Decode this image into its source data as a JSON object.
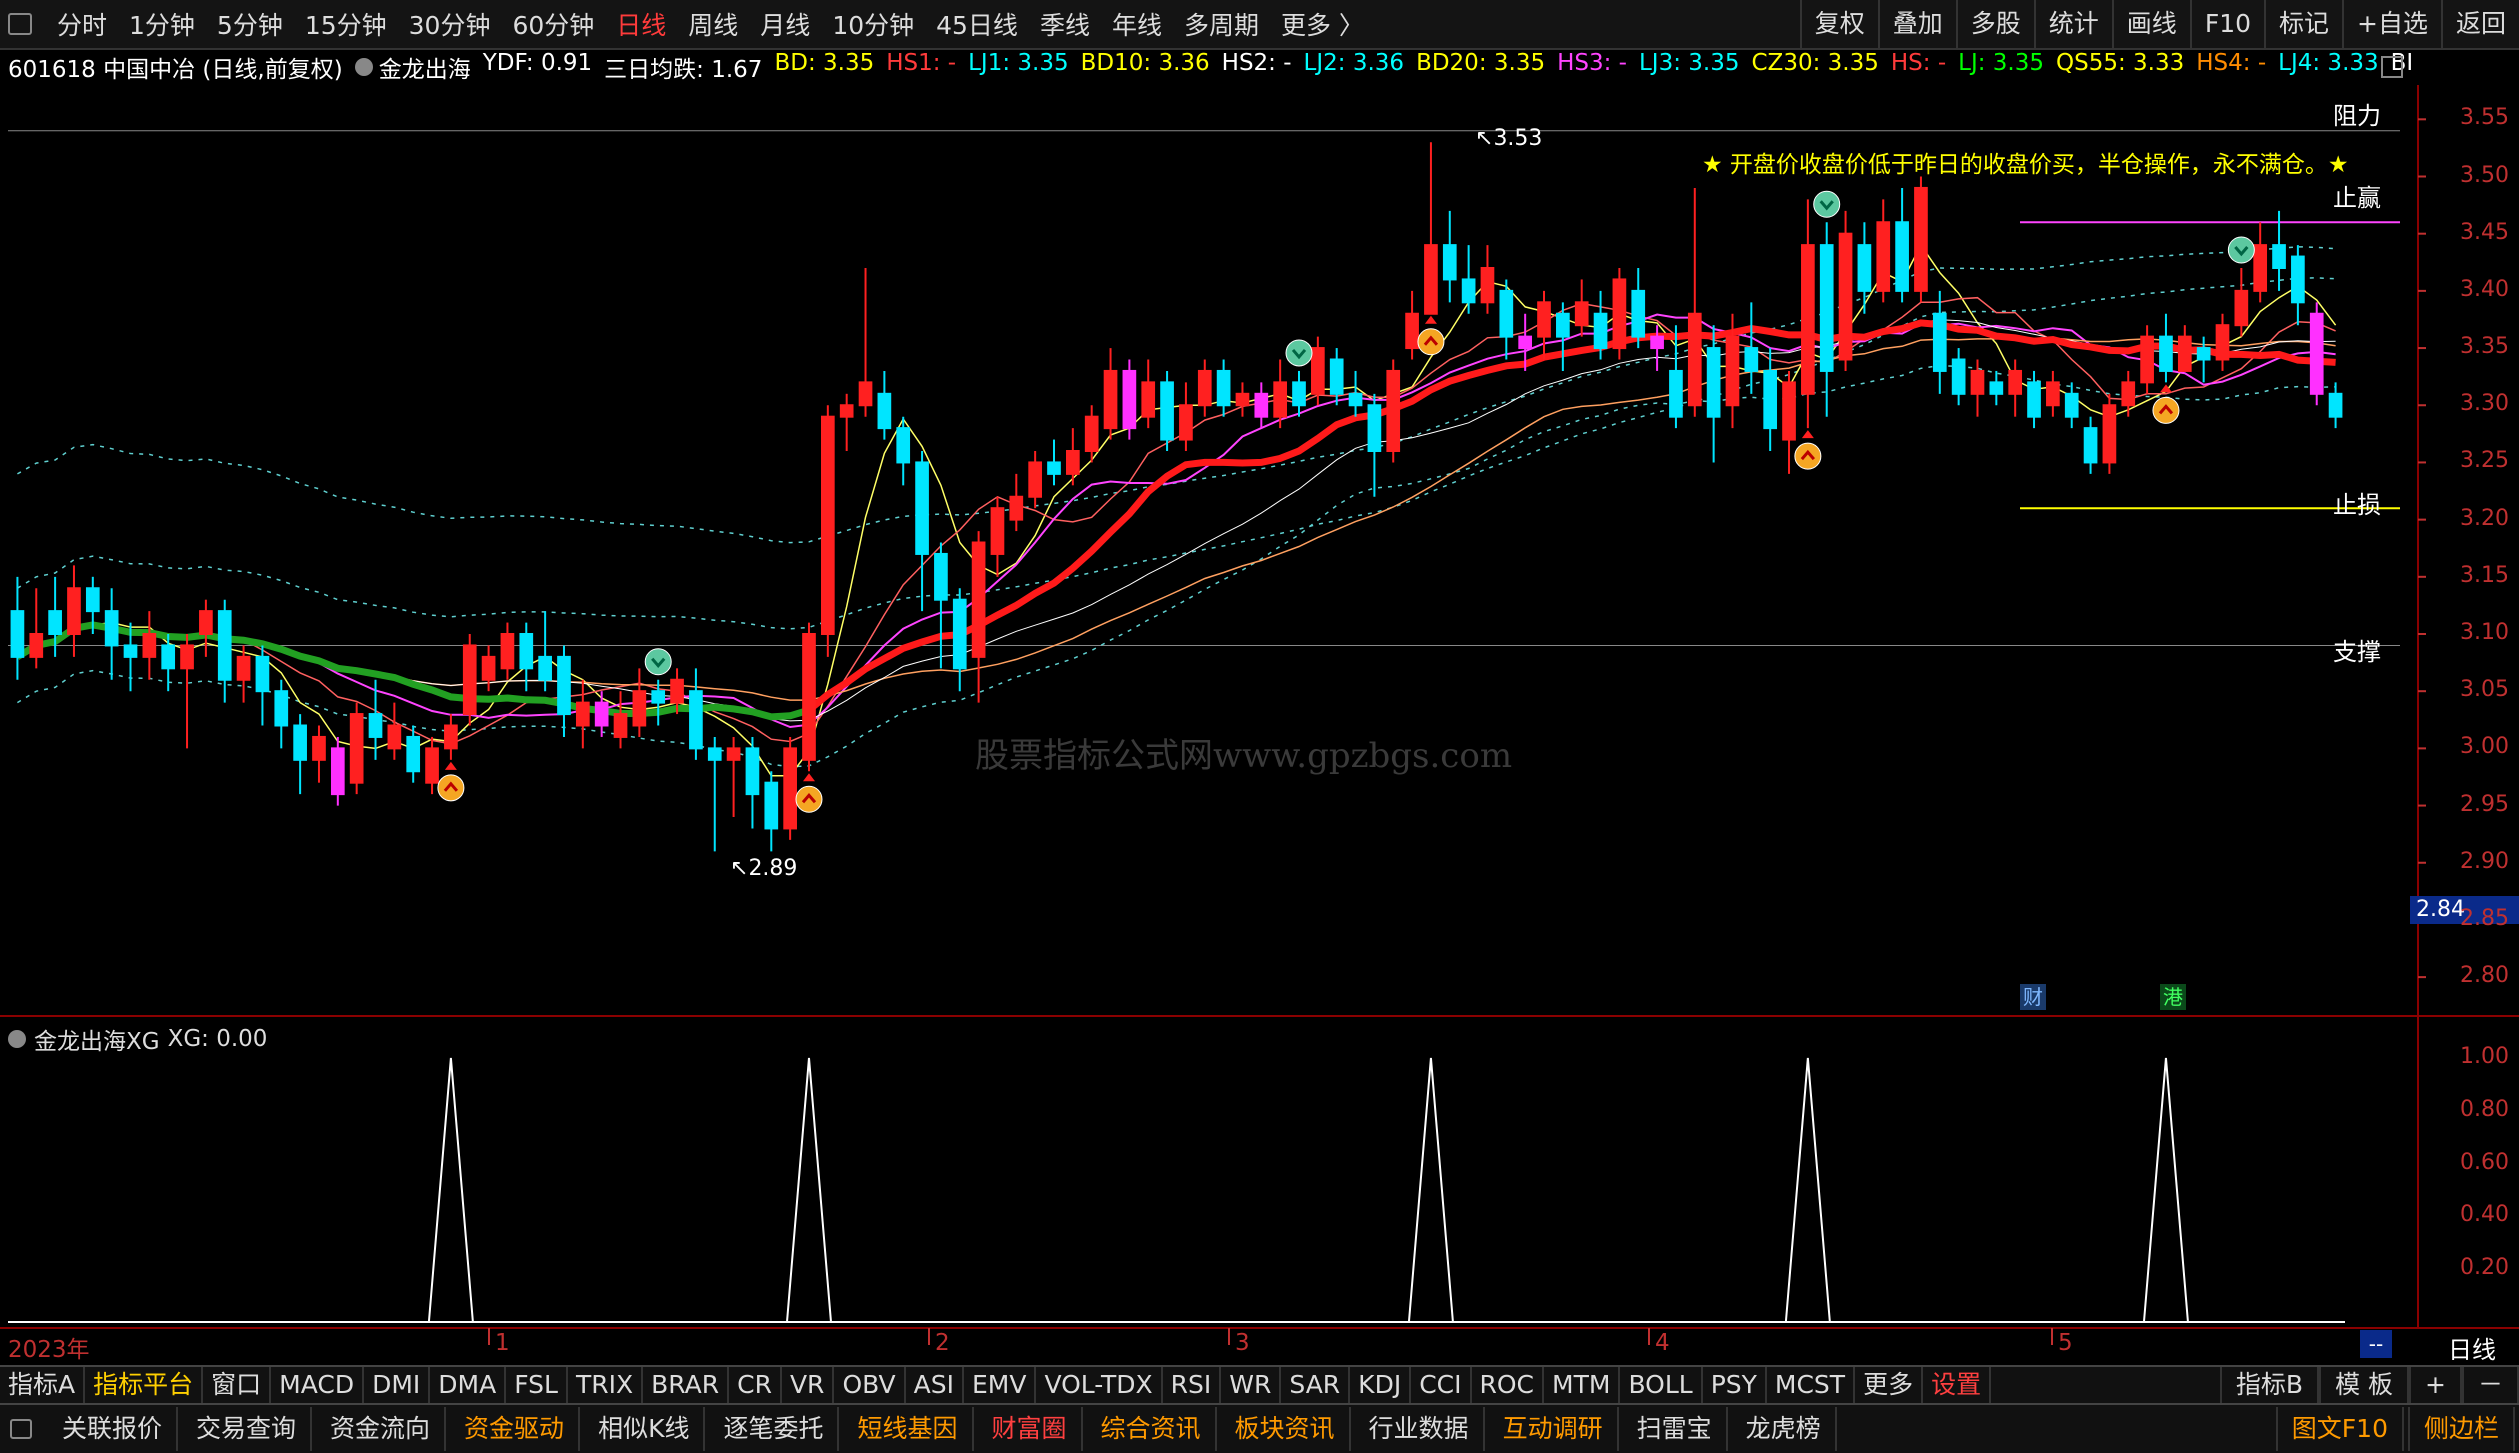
{
  "topbar": {
    "periods": [
      "分时",
      "1分钟",
      "5分钟",
      "15分钟",
      "30分钟",
      "60分钟",
      "日线",
      "周线",
      "月线",
      "10分钟",
      "45日线",
      "季线",
      "年线",
      "多周期",
      "更多 〉"
    ],
    "active_period": "日线",
    "right_buttons": [
      "复权",
      "叠加",
      "多股",
      "统计",
      "画线",
      "F10",
      "标记",
      "+自选",
      "返回"
    ]
  },
  "info": {
    "code_name": "601618 中国中冶 (日线,前复权)",
    "indicator": "金龙出海",
    "values": [
      {
        "text": "YDF: 0.91",
        "color": "#ffffff"
      },
      {
        "text": "三日均跌: 1.67",
        "color": "#ffffff"
      },
      {
        "text": "BD: 3.35",
        "color": "#ffff00"
      },
      {
        "text": "HS1: -",
        "color": "#ff3b3b"
      },
      {
        "text": "LJ1: 3.35",
        "color": "#00ffff"
      },
      {
        "text": "BD10: 3.36",
        "color": "#ffff00"
      },
      {
        "text": "HS2: -",
        "color": "#ffffff"
      },
      {
        "text": "LJ2: 3.36",
        "color": "#00ffff"
      },
      {
        "text": "BD20: 3.35",
        "color": "#ffff00"
      },
      {
        "text": "HS3: -",
        "color": "#ff44ff"
      },
      {
        "text": "LJ3: 3.35",
        "color": "#00ffff"
      },
      {
        "text": "CZ30: 3.35",
        "color": "#ffff00"
      },
      {
        "text": "HS: -",
        "color": "#ff3b3b"
      },
      {
        "text": "LJ: 3.35",
        "color": "#00ff00"
      },
      {
        "text": "QS55: 3.33",
        "color": "#ffff00"
      },
      {
        "text": "HS4: -",
        "color": "#ff8c00"
      },
      {
        "text": "LJ4: 3.33",
        "color": "#00ffff"
      },
      {
        "text": "BI",
        "color": "#ffffff"
      }
    ]
  },
  "main": {
    "watermark": "股票指标公式网www.gpzbgs.com",
    "note": "★ 开盘价收盘价低于昨日的收盘价买，半仓操作，永不满仓。★",
    "labels": {
      "resistance": "阻力",
      "take_profit": "止赢",
      "stop_loss": "止损",
      "support": "支撑"
    },
    "high_label": "3.53",
    "low_label": "2.89",
    "price_tag": "2.84",
    "badges": [
      "财",
      "港"
    ],
    "y_ticks": [
      "3.55",
      "3.50",
      "3.45",
      "3.40",
      "3.35",
      "3.30",
      "3.25",
      "3.20",
      "3.15",
      "3.10",
      "3.05",
      "3.00",
      "2.95",
      "2.90",
      "2.85",
      "2.80"
    ]
  },
  "sub": {
    "title": "金龙出海XG",
    "value": "XG: 0.00",
    "y_ticks": [
      "1.00",
      "0.80",
      "0.60",
      "0.40",
      "0.20"
    ]
  },
  "xaxis": {
    "labels": [
      "2023年",
      "1",
      "2",
      "3",
      "4",
      "5"
    ],
    "right_tag": "--",
    "period_label": "日线"
  },
  "indicator_tabs": [
    "指标A",
    "指标平台",
    "窗口",
    "MACD",
    "DMI",
    "DMA",
    "FSL",
    "TRIX",
    "BRAR",
    "CR",
    "VR",
    "OBV",
    "ASI",
    "EMV",
    "VOL-TDX",
    "RSI",
    "WR",
    "SAR",
    "KDJ",
    "CCI",
    "ROC",
    "MTM",
    "BOLL",
    "PSY",
    "MCST",
    "更多",
    "设置"
  ],
  "indicator_right": [
    "指标B",
    "模 板",
    "+",
    "－"
  ],
  "function_tabs": [
    {
      "label": "关联报价",
      "color": "#dddddd"
    },
    {
      "label": "交易查询",
      "color": "#dddddd"
    },
    {
      "label": "资金流向",
      "color": "#dddddd"
    },
    {
      "label": "资金驱动",
      "color": "#ff9a00"
    },
    {
      "label": "相似K线",
      "color": "#dddddd"
    },
    {
      "label": "逐笔委托",
      "color": "#dddddd"
    },
    {
      "label": "短线基因",
      "color": "#ff9a00"
    },
    {
      "label": "财富圈",
      "color": "#ff4040"
    },
    {
      "label": "综合资讯",
      "color": "#ff9a00"
    },
    {
      "label": "板块资讯",
      "color": "#ff9a00"
    },
    {
      "label": "行业数据",
      "color": "#dddddd"
    },
    {
      "label": "互动调研",
      "color": "#ff9a00"
    },
    {
      "label": "扫雷宝",
      "color": "#dddddd"
    },
    {
      "label": "龙虎榜",
      "color": "#dddddd"
    }
  ],
  "function_right": [
    "图文F10",
    "侧边栏"
  ],
  "chart_data": {
    "type": "candlestick",
    "ylim": [
      2.78,
      3.58
    ],
    "candles": [
      [
        3.12,
        3.08,
        3.15,
        3.06
      ],
      [
        3.08,
        3.1,
        3.14,
        3.07
      ],
      [
        3.12,
        3.1,
        3.15,
        3.08
      ],
      [
        3.1,
        3.14,
        3.16,
        3.08
      ],
      [
        3.14,
        3.12,
        3.15,
        3.1
      ],
      [
        3.12,
        3.09,
        3.14,
        3.06
      ],
      [
        3.09,
        3.08,
        3.11,
        3.05
      ],
      [
        3.08,
        3.1,
        3.12,
        3.06
      ],
      [
        3.09,
        3.07,
        3.1,
        3.05
      ],
      [
        3.07,
        3.09,
        3.1,
        3.0
      ],
      [
        3.1,
        3.12,
        3.13,
        3.08
      ],
      [
        3.12,
        3.06,
        3.13,
        3.04
      ],
      [
        3.06,
        3.08,
        3.09,
        3.04
      ],
      [
        3.08,
        3.05,
        3.09,
        3.02
      ],
      [
        3.05,
        3.02,
        3.06,
        3.0
      ],
      [
        3.02,
        2.99,
        3.03,
        2.96
      ],
      [
        2.99,
        3.01,
        3.02,
        2.97
      ],
      [
        3.0,
        2.96,
        3.01,
        2.95
      ],
      [
        2.97,
        3.03,
        3.04,
        2.96
      ],
      [
        3.03,
        3.01,
        3.06,
        2.99
      ],
      [
        3.0,
        3.02,
        3.04,
        2.99
      ],
      [
        3.01,
        2.98,
        3.02,
        2.97
      ],
      [
        2.97,
        3.0,
        3.01,
        2.96
      ],
      [
        3.0,
        3.02,
        3.03,
        2.99
      ],
      [
        3.03,
        3.09,
        3.1,
        3.02
      ],
      [
        3.06,
        3.08,
        3.09,
        3.05
      ],
      [
        3.07,
        3.1,
        3.11,
        3.06
      ],
      [
        3.1,
        3.07,
        3.11,
        3.05
      ],
      [
        3.08,
        3.06,
        3.12,
        3.05
      ],
      [
        3.08,
        3.03,
        3.09,
        3.01
      ],
      [
        3.02,
        3.04,
        3.06,
        3.0
      ],
      [
        3.04,
        3.02,
        3.05,
        3.01
      ],
      [
        3.01,
        3.03,
        3.05,
        3.0
      ],
      [
        3.02,
        3.05,
        3.07,
        3.01
      ],
      [
        3.05,
        3.04,
        3.06,
        3.02
      ],
      [
        3.04,
        3.06,
        3.07,
        3.03
      ],
      [
        3.05,
        3.0,
        3.07,
        2.99
      ],
      [
        3.0,
        2.99,
        3.01,
        2.91
      ],
      [
        2.99,
        3.0,
        3.01,
        2.94
      ],
      [
        3.0,
        2.96,
        3.01,
        2.93
      ],
      [
        2.97,
        2.93,
        2.98,
        2.91
      ],
      [
        2.93,
        3.0,
        3.01,
        2.92
      ],
      [
        2.99,
        3.1,
        3.11,
        2.98
      ],
      [
        3.1,
        3.29,
        3.3,
        3.08
      ],
      [
        3.29,
        3.3,
        3.31,
        3.26
      ],
      [
        3.3,
        3.32,
        3.42,
        3.29
      ],
      [
        3.31,
        3.28,
        3.33,
        3.27
      ],
      [
        3.28,
        3.25,
        3.29,
        3.23
      ],
      [
        3.25,
        3.17,
        3.26,
        3.12
      ],
      [
        3.17,
        3.13,
        3.18,
        3.07
      ],
      [
        3.13,
        3.07,
        3.14,
        3.05
      ],
      [
        3.08,
        3.18,
        3.19,
        3.04
      ],
      [
        3.17,
        3.21,
        3.22,
        3.15
      ],
      [
        3.2,
        3.22,
        3.24,
        3.19
      ],
      [
        3.22,
        3.25,
        3.26,
        3.21
      ],
      [
        3.25,
        3.24,
        3.27,
        3.23
      ],
      [
        3.24,
        3.26,
        3.28,
        3.23
      ],
      [
        3.26,
        3.29,
        3.3,
        3.25
      ],
      [
        3.28,
        3.33,
        3.35,
        3.27
      ],
      [
        3.33,
        3.28,
        3.34,
        3.27
      ],
      [
        3.29,
        3.32,
        3.34,
        3.28
      ],
      [
        3.32,
        3.27,
        3.33,
        3.26
      ],
      [
        3.27,
        3.3,
        3.32,
        3.26
      ],
      [
        3.3,
        3.33,
        3.34,
        3.29
      ],
      [
        3.33,
        3.3,
        3.34,
        3.29
      ],
      [
        3.3,
        3.31,
        3.32,
        3.29
      ],
      [
        3.31,
        3.29,
        3.32,
        3.28
      ],
      [
        3.29,
        3.32,
        3.34,
        3.28
      ],
      [
        3.32,
        3.3,
        3.33,
        3.29
      ],
      [
        3.31,
        3.35,
        3.36,
        3.3
      ],
      [
        3.34,
        3.31,
        3.35,
        3.3
      ],
      [
        3.31,
        3.3,
        3.33,
        3.29
      ],
      [
        3.3,
        3.26,
        3.31,
        3.22
      ],
      [
        3.26,
        3.33,
        3.34,
        3.25
      ],
      [
        3.35,
        3.38,
        3.4,
        3.34
      ],
      [
        3.38,
        3.44,
        3.53,
        3.38
      ],
      [
        3.44,
        3.41,
        3.47,
        3.39
      ],
      [
        3.41,
        3.39,
        3.44,
        3.38
      ],
      [
        3.39,
        3.42,
        3.44,
        3.38
      ],
      [
        3.4,
        3.36,
        3.41,
        3.34
      ],
      [
        3.36,
        3.35,
        3.38,
        3.33
      ],
      [
        3.36,
        3.39,
        3.4,
        3.34
      ],
      [
        3.38,
        3.36,
        3.39,
        3.33
      ],
      [
        3.37,
        3.39,
        3.41,
        3.36
      ],
      [
        3.38,
        3.35,
        3.4,
        3.34
      ],
      [
        3.35,
        3.41,
        3.42,
        3.34
      ],
      [
        3.4,
        3.36,
        3.42,
        3.35
      ],
      [
        3.36,
        3.35,
        3.37,
        3.33
      ],
      [
        3.33,
        3.29,
        3.37,
        3.28
      ],
      [
        3.3,
        3.38,
        3.49,
        3.29
      ],
      [
        3.35,
        3.29,
        3.37,
        3.25
      ],
      [
        3.3,
        3.36,
        3.38,
        3.28
      ],
      [
        3.35,
        3.33,
        3.39,
        3.31
      ],
      [
        3.33,
        3.28,
        3.35,
        3.26
      ],
      [
        3.27,
        3.32,
        3.33,
        3.24
      ],
      [
        3.31,
        3.44,
        3.48,
        3.28
      ],
      [
        3.44,
        3.33,
        3.46,
        3.29
      ],
      [
        3.34,
        3.45,
        3.47,
        3.33
      ],
      [
        3.44,
        3.4,
        3.46,
        3.38
      ],
      [
        3.4,
        3.46,
        3.48,
        3.39
      ],
      [
        3.46,
        3.4,
        3.49,
        3.39
      ],
      [
        3.4,
        3.49,
        3.5,
        3.39
      ],
      [
        3.38,
        3.33,
        3.4,
        3.31
      ],
      [
        3.34,
        3.31,
        3.35,
        3.3
      ],
      [
        3.31,
        3.33,
        3.34,
        3.29
      ],
      [
        3.32,
        3.31,
        3.33,
        3.3
      ],
      [
        3.31,
        3.33,
        3.34,
        3.29
      ],
      [
        3.32,
        3.29,
        3.33,
        3.28
      ],
      [
        3.3,
        3.32,
        3.33,
        3.29
      ],
      [
        3.31,
        3.29,
        3.32,
        3.28
      ],
      [
        3.28,
        3.25,
        3.29,
        3.24
      ],
      [
        3.25,
        3.3,
        3.31,
        3.24
      ],
      [
        3.3,
        3.32,
        3.33,
        3.29
      ],
      [
        3.32,
        3.36,
        3.37,
        3.31
      ],
      [
        3.36,
        3.33,
        3.38,
        3.32
      ],
      [
        3.33,
        3.36,
        3.37,
        3.33
      ],
      [
        3.35,
        3.34,
        3.36,
        3.32
      ],
      [
        3.34,
        3.37,
        3.38,
        3.33
      ],
      [
        3.37,
        3.4,
        3.42,
        3.36
      ],
      [
        3.4,
        3.44,
        3.46,
        3.39
      ],
      [
        3.44,
        3.42,
        3.47,
        3.4
      ],
      [
        3.43,
        3.39,
        3.44,
        3.37
      ],
      [
        3.38,
        3.31,
        3.39,
        3.3
      ],
      [
        3.31,
        3.29,
        3.32,
        3.28
      ]
    ],
    "signals_xg": [
      23,
      42,
      75,
      95,
      114
    ],
    "levels": {
      "take_profit": 3.46,
      "stop_loss": 3.21,
      "support": 3.09
    }
  }
}
